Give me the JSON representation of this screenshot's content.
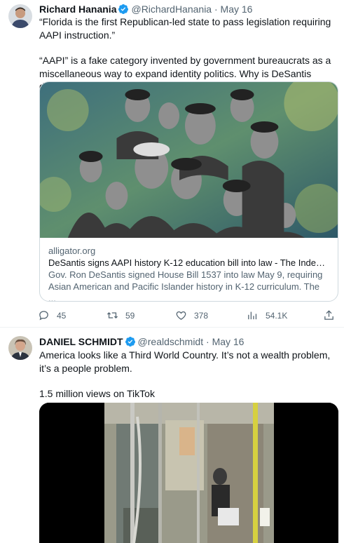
{
  "colors": {
    "accent": "#1d9bf0",
    "text": "#0f1419",
    "muted": "#536471",
    "border": "#cfd9de"
  },
  "tweets": [
    {
      "author": "Richard Hanania",
      "handle": "@RichardHanania",
      "date": "May 16",
      "separator": "·",
      "text_line1": "“Florida is the first Republican-led state to pass legislation requiring AAPI instruction.”",
      "text_line2": "“AAPI” is a fake category invented by government bureaucrats as a miscellaneous way to expand identity politics. Why is DeSantis doing this?",
      "card": {
        "domain": "alligator.org",
        "title": "DeSantis signs AAPI history K-12 education bill into law - The Indepe...",
        "description": "Gov. Ron DeSantis signed House Bill 1537 into law May 9, requiring Asian American and Pacific Islander history in K-12 curriculum. The ..."
      },
      "stats": {
        "replies": "45",
        "retweets": "59",
        "likes": "378",
        "views": "54.1K"
      },
      "icons": [
        "verified-badge-icon",
        "more-icon",
        "reply-icon",
        "retweet-icon",
        "like-icon",
        "views-icon",
        "share-icon"
      ]
    },
    {
      "author": "DANIEL SCHMIDT",
      "handle": "@realdschmidt",
      "date": "May 16",
      "separator": "·",
      "text_line1": "America looks like a Third World Country. It’s not a wealth problem, it’s a people problem.",
      "text_line2": "1.5 million views on TikTok"
    }
  ]
}
